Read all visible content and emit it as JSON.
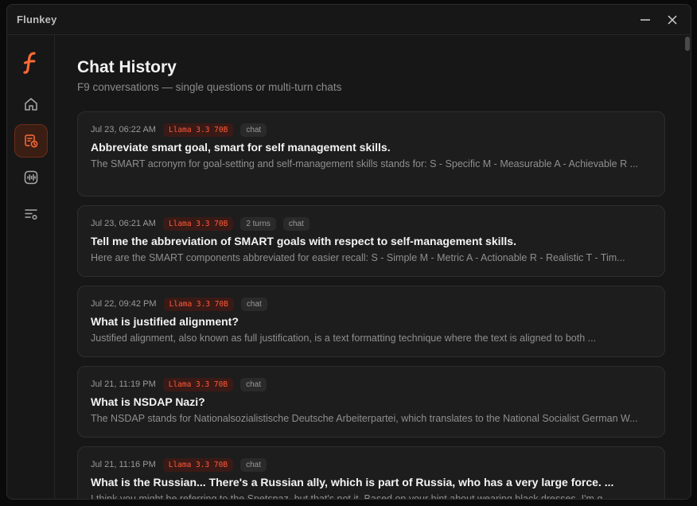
{
  "window": {
    "title": "Flunkey"
  },
  "sidebar": {
    "items": [
      {
        "id": "home",
        "icon": "home-icon"
      },
      {
        "id": "chat-history",
        "icon": "chat-history-icon",
        "active": true
      },
      {
        "id": "audio",
        "icon": "waveform-icon"
      },
      {
        "id": "settings",
        "icon": "list-settings-icon"
      }
    ]
  },
  "page": {
    "title": "Chat History",
    "subtitle": "F9 conversations — single questions or multi-turn chats"
  },
  "colors": {
    "accent": "#ff6a33",
    "model_badge_text": "#ff5a3a",
    "background": "#171717",
    "card": "#1d1d1d"
  },
  "chats": [
    {
      "date": "Jul 23, 06:22 AM",
      "model": "Llama 3.3 70B",
      "turns": "",
      "type": "chat",
      "title": "Abbreviate smart goal, smart for self management skills.",
      "preview": "The SMART acronym for goal-setting and self-management skills stands for: S - Specific M - Measurable A - Achievable R ..."
    },
    {
      "date": "Jul 23, 06:21 AM",
      "model": "Llama 3.3 70B",
      "turns": "2 turns",
      "type": "chat",
      "title": "Tell me the abbreviation of SMART goals with respect to self-management skills.",
      "preview": "Here are the SMART components abbreviated for easier recall: S - Simple M - Metric A - Actionable R - Realistic T - Tim..."
    },
    {
      "date": "Jul 22, 09:42 PM",
      "model": "Llama 3.3 70B",
      "turns": "",
      "type": "chat",
      "title": "What is justified alignment?",
      "preview": "Justified alignment, also known as full justification, is a text formatting technique where the text is aligned to both ..."
    },
    {
      "date": "Jul 21, 11:19 PM",
      "model": "Llama 3.3 70B",
      "turns": "",
      "type": "chat",
      "title": "What is NSDAP Nazi?",
      "preview": "The NSDAP stands for Nationalsozialistische Deutsche Arbeiterpartei, which translates to the National Socialist German W..."
    },
    {
      "date": "Jul 21, 11:16 PM",
      "model": "Llama 3.3 70B",
      "turns": "",
      "type": "chat",
      "title": "What is the Russian... There's a Russian ally, which is part of Russia, who has a very large force. ...",
      "preview": "I think you might be referring to the Spetsnaz, but that's not it. Based on your hint about wearing black dresses, I'm g..."
    }
  ]
}
